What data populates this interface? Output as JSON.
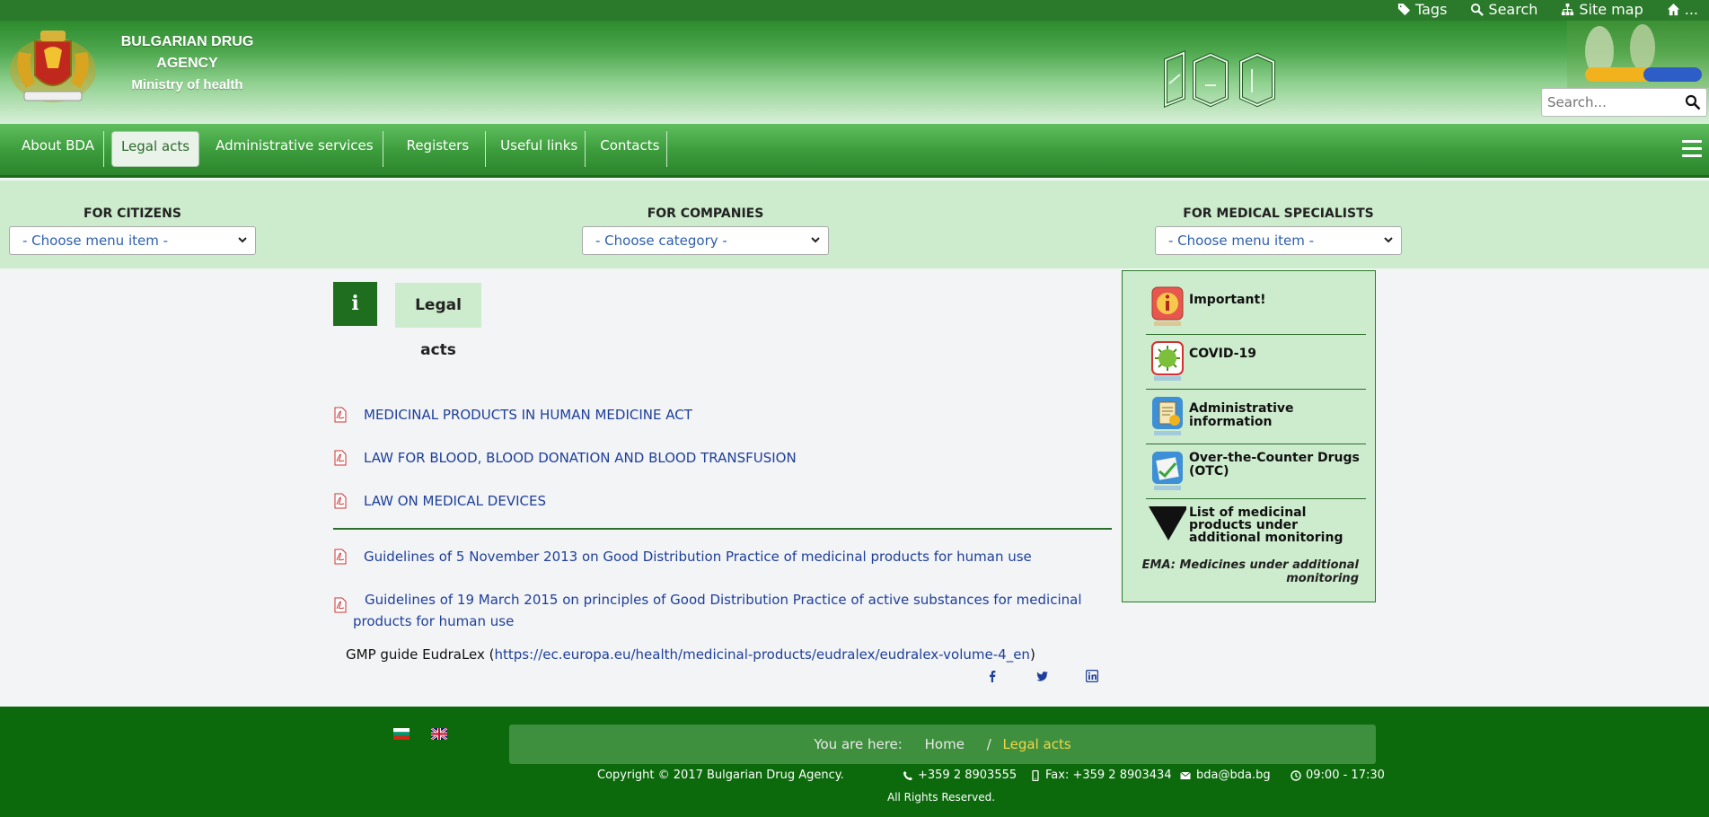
{
  "topbar": {
    "tags": "Tags",
    "search": "Search",
    "sitemap": "Site map",
    "home": "..."
  },
  "header": {
    "org_line1": "BULGARIAN DRUG",
    "org_line2": "AGENCY",
    "ministry": "Ministry of health",
    "search_placeholder": "Search..."
  },
  "nav": {
    "items": [
      "About BDA",
      "Legal acts",
      "Administrative services",
      "Registers",
      "Useful links",
      "Contacts"
    ],
    "active": "Legal acts"
  },
  "audience": {
    "citizens_title": "FOR CITIZENS",
    "citizens_value": "- Choose menu item -",
    "companies_title": "FOR COMPANIES",
    "companies_value": "- Choose category -",
    "specialists_title": "FOR MEDICAL SPECIALISTS",
    "specialists_value": "- Choose menu item -"
  },
  "main": {
    "info_glyph": "i",
    "page_title": "Legal acts",
    "docs": [
      "MEDICINAL PRODUCTS IN HUMAN MEDICINE ACT",
      "LAW FOR BLOOD, BLOOD DONATION AND BLOOD TRANSFUSION",
      "LAW ON MEDICAL DEVICES"
    ],
    "guidelines": [
      "Guidelines of 5 November 2013 on Good Distribution Practice of medicinal products for human use",
      "Guidelines of 19 March 2015 on principles of Good Distribution Practice of active substances for medicinal products for human use"
    ],
    "gmp_prefix": "GMP guide EudraLex (",
    "gmp_link": "https://ec.europa.eu/health/medicinal-products/eudralex/eudralex-volume-4_en",
    "gmp_suffix": ")"
  },
  "side": {
    "items": [
      "Important!",
      "COVID-19",
      "Administrative information",
      "Over-the-Counter Drugs (OTC)",
      "List of medicinal products under additional monitoring"
    ],
    "ema_line1": "EMA: Medicines under additional",
    "ema_line2": "monitoring"
  },
  "footer": {
    "you_are_here": "You are here:",
    "home": "Home",
    "sep": "/",
    "current": "Legal acts",
    "copyright": "Copyright © 2017 Bulgarian Drug Agency.",
    "phone": "+359 2 8903555",
    "fax": "Fax: +359 2 8903434",
    "email": "bda@bda.bg",
    "hours": "09:00 - 17:30",
    "rights": "All Rights Reserved."
  },
  "colors": {
    "brand_green": "#2b7a2b",
    "light_green": "#cdebcd",
    "footer_green": "#0c6a0c",
    "link_blue": "#1e3f9a",
    "breadcrumb_current": "#f0d64a"
  }
}
